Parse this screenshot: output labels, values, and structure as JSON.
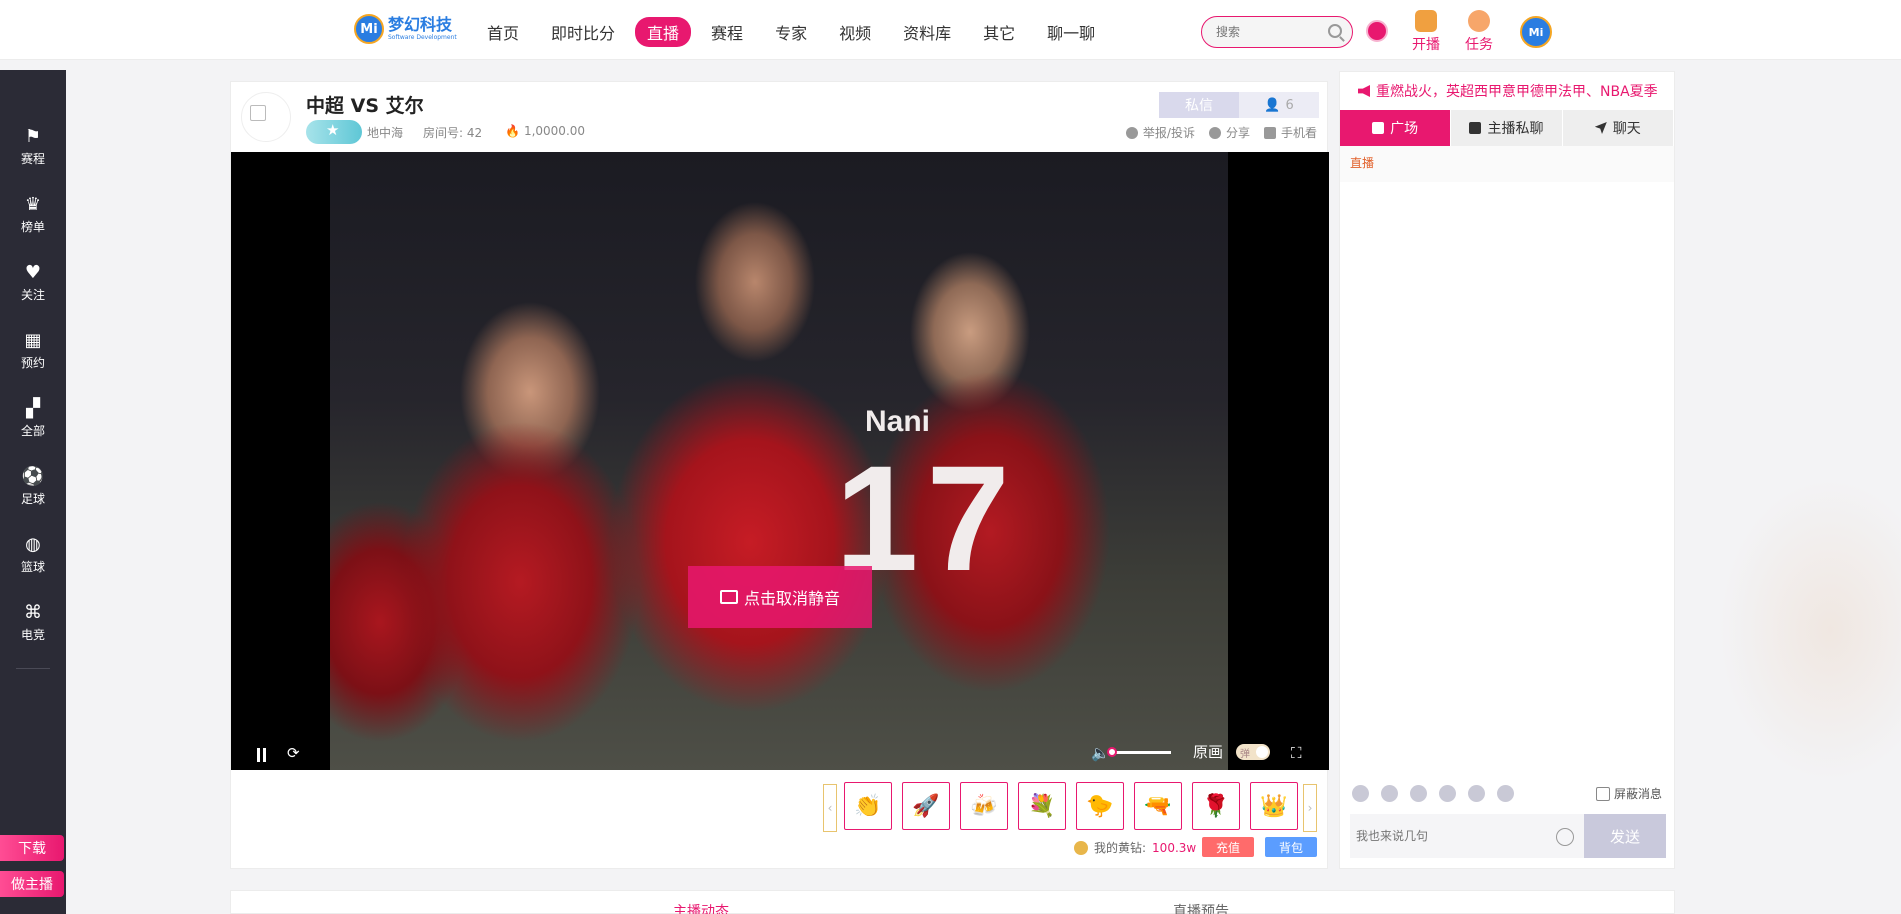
{
  "header": {
    "logo": {
      "cn": "梦幻科技",
      "en": "Software Development",
      "mark": "Mi"
    },
    "nav": [
      {
        "label": "首页"
      },
      {
        "label": "即时比分"
      },
      {
        "label": "直播",
        "active": true
      },
      {
        "label": "赛程"
      },
      {
        "label": "专家"
      },
      {
        "label": "视频"
      },
      {
        "label": "资料库"
      },
      {
        "label": "其它"
      },
      {
        "label": "聊一聊"
      }
    ],
    "search_placeholder": "搜索",
    "live_label": "开播",
    "task_label": "任务",
    "avatar_text": "Mi"
  },
  "sidebar": {
    "items": [
      {
        "label": "赛程",
        "icon": "flag-icon",
        "glyph": "⚑"
      },
      {
        "label": "榜单",
        "icon": "trophy-icon",
        "glyph": "♛"
      },
      {
        "label": "关注",
        "icon": "heart-icon",
        "glyph": "♥"
      },
      {
        "label": "预约",
        "icon": "calendar-icon",
        "glyph": "▦"
      },
      {
        "label": "全部",
        "icon": "grid-icon",
        "glyph": "▞"
      },
      {
        "label": "足球",
        "icon": "football-icon",
        "glyph": "⚽"
      },
      {
        "label": "篮球",
        "icon": "basketball-icon",
        "glyph": "◍"
      },
      {
        "label": "电竞",
        "icon": "gamepad-icon",
        "glyph": "⌘"
      }
    ],
    "download_label": "下载",
    "become_host_label": "做主播"
  },
  "room": {
    "title": "中超 VS 艾尔",
    "host_name": "地中海",
    "room_number": "房间号: 42",
    "heat": "1,0000.00",
    "private_msg": "私信",
    "viewer_count": "6",
    "report": "举报/投诉",
    "share": "分享",
    "mobile": "手机看"
  },
  "video": {
    "jersey_name": "Nani",
    "jersey_number": "17",
    "unmute_label": "点击取消静音",
    "quality_label": "原画",
    "danmaku_label": "弹",
    "volume": 0
  },
  "gifts": {
    "items": [
      {
        "icon": "gift-hand-icon",
        "glyph": "👏"
      },
      {
        "icon": "gift-rocket-icon",
        "glyph": "🚀"
      },
      {
        "icon": "gift-cheers-icon",
        "glyph": "🍻"
      },
      {
        "icon": "gift-love-icon",
        "glyph": "💐"
      },
      {
        "icon": "gift-duck-icon",
        "glyph": "🐤"
      },
      {
        "icon": "gift-gun-icon",
        "glyph": "🔫"
      },
      {
        "icon": "gift-rose-icon",
        "glyph": "🌹"
      },
      {
        "icon": "gift-crown-icon",
        "glyph": "👑"
      }
    ],
    "wallet_label": "我的黄钻:",
    "wallet_amount": "100.3w",
    "recharge_label": "充值",
    "bag_label": "背包"
  },
  "chat": {
    "notice": "重燃战火，英超西甲意甲德甲法甲、NBA夏季",
    "tabs": [
      {
        "label": "广场",
        "active": true
      },
      {
        "label": "主播私聊"
      },
      {
        "label": "聊天"
      }
    ],
    "sub_label": "直播",
    "block_label": "屏蔽消息",
    "input_placeholder": "我也来说几句",
    "send_label": "发送"
  },
  "bottom_tabs": [
    {
      "label": "主播动态",
      "active": true
    },
    {
      "label": "直播预告"
    }
  ],
  "colors": {
    "accent": "#e8186f",
    "sidebar_bg": "#2b2b36",
    "notice": "#e8186f"
  }
}
